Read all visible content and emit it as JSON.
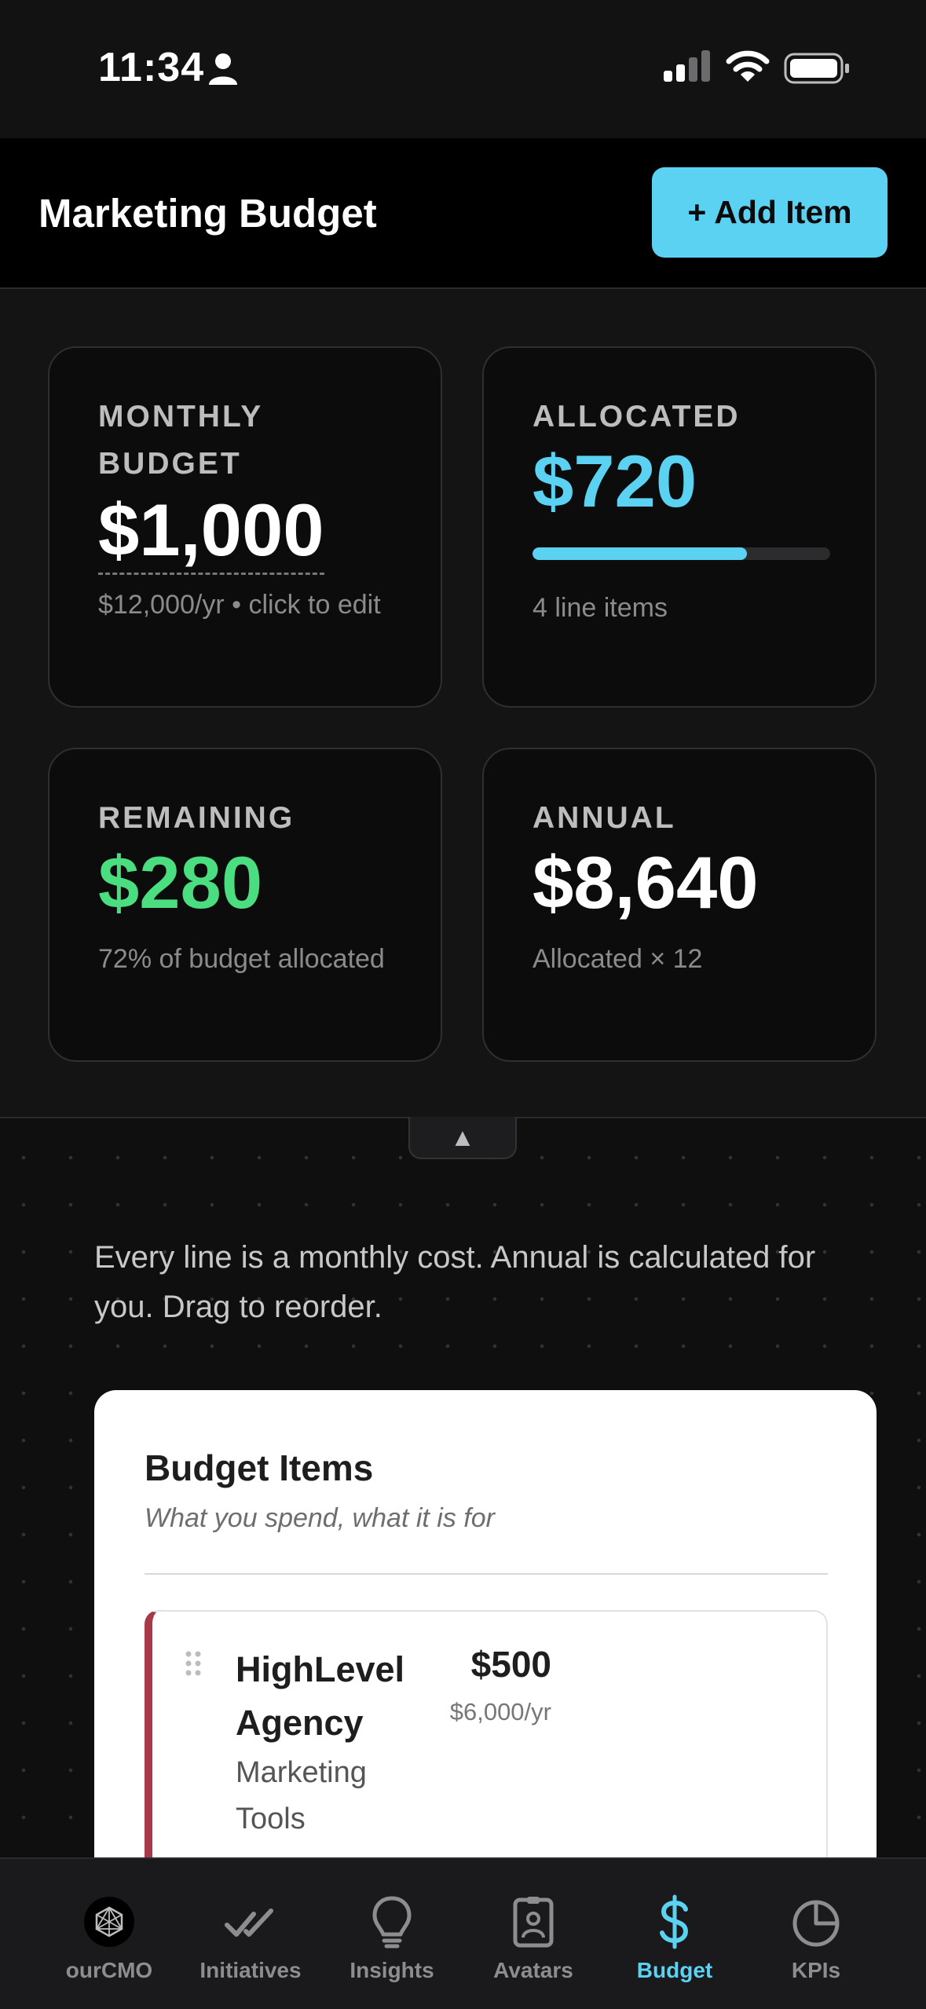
{
  "status_bar": {
    "time": "11:34"
  },
  "header": {
    "title": "Marketing Budget",
    "add_button": "+ Add Item"
  },
  "colors": {
    "accent": "#5cd2f2",
    "positive": "#4ade80",
    "item_stripe": "#a63a48"
  },
  "stats": {
    "monthly": {
      "label": "MONTHLY BUDGET",
      "value": "$1,000",
      "sub": "$12,000/yr • click to edit"
    },
    "allocated": {
      "label": "ALLOCATED",
      "value": "$720",
      "progress_percent": 72,
      "sub": "4 line items"
    },
    "remaining": {
      "label": "REMAINING",
      "value": "$280",
      "sub": "72% of budget allocated"
    },
    "annual": {
      "label": "ANNUAL",
      "value": "$8,640",
      "sub": "Allocated × 12"
    }
  },
  "collapse_toggle": "▲",
  "hint": "Every line is a monthly cost. Annual is calculated for you. Drag to reorder.",
  "budget_items": {
    "title": "Budget Items",
    "subtitle": "What you spend, what it is for",
    "items": [
      {
        "name": "HighLevel Agency",
        "category": "Marketing Tools",
        "amount": "$500",
        "annual": "$6,000/yr"
      }
    ]
  },
  "tabs": [
    {
      "label": "ourCMO",
      "icon": "ourcmo-logo-icon"
    },
    {
      "label": "Initiatives",
      "icon": "double-check-icon"
    },
    {
      "label": "Insights",
      "icon": "lightbulb-icon"
    },
    {
      "label": "Avatars",
      "icon": "id-badge-icon"
    },
    {
      "label": "Budget",
      "icon": "dollar-icon",
      "active": true
    },
    {
      "label": "KPIs",
      "icon": "pie-chart-icon"
    }
  ]
}
